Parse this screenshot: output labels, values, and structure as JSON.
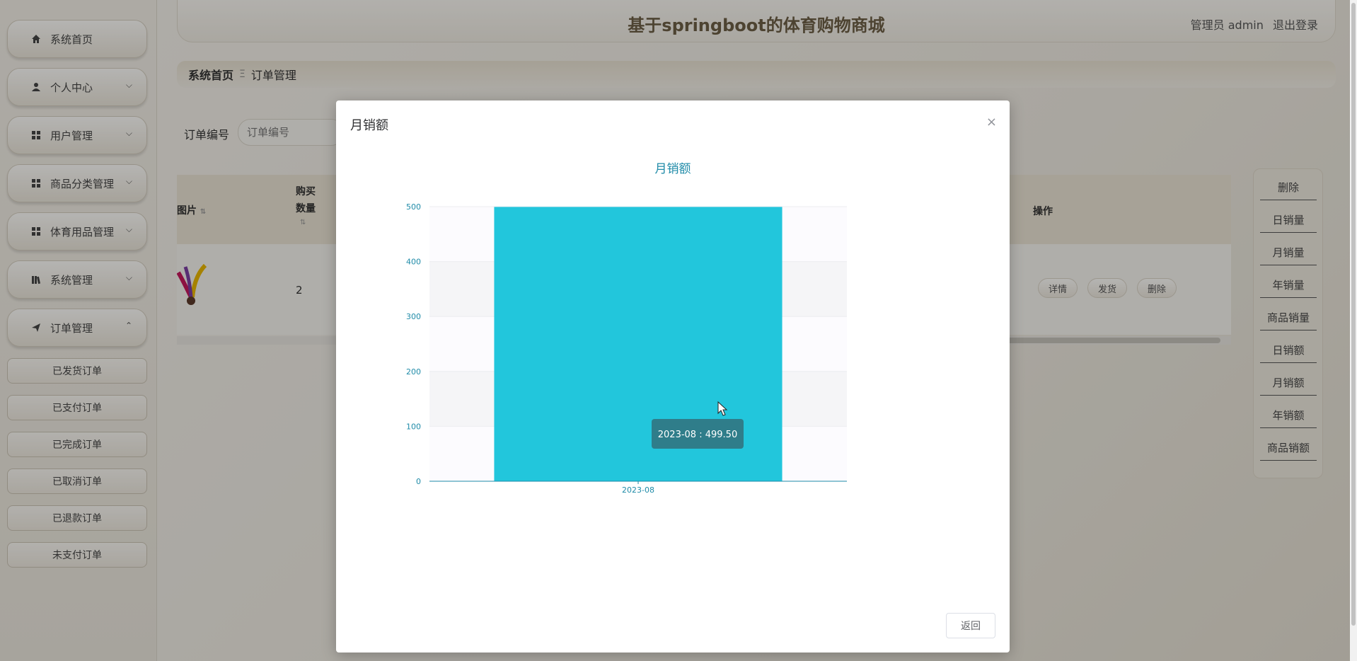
{
  "header": {
    "site_title": "基于springboot的体育购物商城",
    "role": "管理员 admin",
    "logout": "退出登录"
  },
  "sidebar": {
    "items": [
      {
        "label": "系统首页",
        "icon": "home-icon"
      },
      {
        "label": "个人中心",
        "icon": "user-icon"
      },
      {
        "label": "用户管理",
        "icon": "grid-icon"
      },
      {
        "label": "商品分类管理",
        "icon": "grid-icon"
      },
      {
        "label": "体育用品管理",
        "icon": "grid-icon"
      },
      {
        "label": "系统管理",
        "icon": "book-icon"
      },
      {
        "label": "订单管理",
        "icon": "send-icon"
      }
    ],
    "order_submenu": [
      "已发货订单",
      "已支付订单",
      "已完成订单",
      "已取消订单",
      "已退款订单",
      "未支付订单"
    ]
  },
  "breadcrumb": {
    "home": "系统首页",
    "sep": "Ξ",
    "current": "订单管理"
  },
  "search": {
    "label": "订单编号",
    "placeholder": "订单编号"
  },
  "table": {
    "columns": [
      "图片",
      "购买数量",
      "操作"
    ],
    "row": {
      "quantity": "2",
      "actions": [
        "详情",
        "发货",
        "删除"
      ]
    }
  },
  "right_panel": {
    "buttons": [
      "删除",
      "日销量",
      "月销量",
      "年销量",
      "商品销量",
      "日销额",
      "月销额",
      "年销额",
      "商品销额"
    ]
  },
  "modal": {
    "title": "月销额",
    "close": "×",
    "return_label": "返回"
  },
  "chart_data": {
    "type": "bar",
    "title": "月销额",
    "categories": [
      "2023-08"
    ],
    "values": [
      499.5
    ],
    "ylim": [
      0,
      500
    ],
    "yticks": [
      0,
      100,
      200,
      300,
      400,
      500
    ],
    "grid": true,
    "bar_color": "#22c6dc",
    "axis_color": "#1f8ba8",
    "tooltip": "2023-08 : 499.50"
  },
  "colors": {
    "accent": "#6b5e45",
    "bar": "#22c6dc",
    "axis_text": "#1f8ba8",
    "tooltip_bg": "#2f7d8a"
  }
}
